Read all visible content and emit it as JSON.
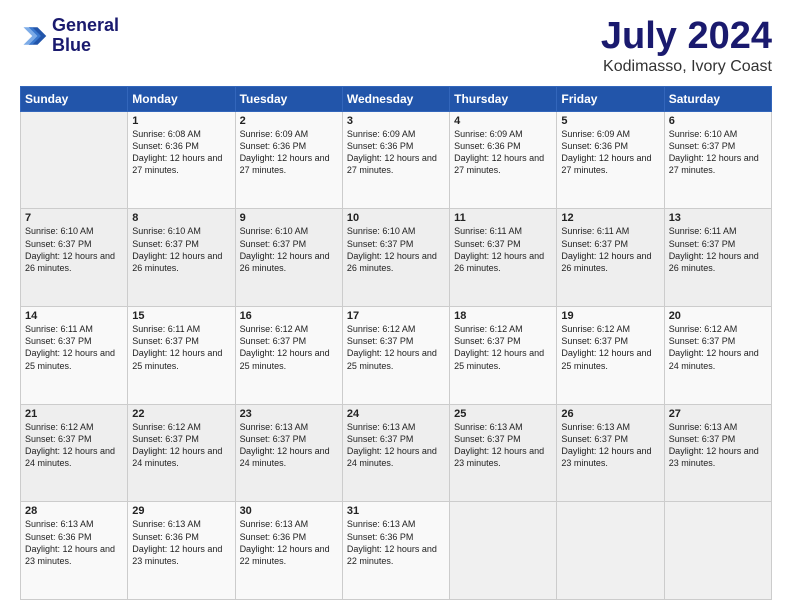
{
  "header": {
    "logo_line1": "General",
    "logo_line2": "Blue",
    "title": "July 2024",
    "subtitle": "Kodimasso, Ivory Coast"
  },
  "days_of_week": [
    "Sunday",
    "Monday",
    "Tuesday",
    "Wednesday",
    "Thursday",
    "Friday",
    "Saturday"
  ],
  "weeks": [
    [
      {
        "day": "",
        "sunrise": "",
        "sunset": "",
        "daylight": ""
      },
      {
        "day": "1",
        "sunrise": "Sunrise: 6:08 AM",
        "sunset": "Sunset: 6:36 PM",
        "daylight": "Daylight: 12 hours and 27 minutes."
      },
      {
        "day": "2",
        "sunrise": "Sunrise: 6:09 AM",
        "sunset": "Sunset: 6:36 PM",
        "daylight": "Daylight: 12 hours and 27 minutes."
      },
      {
        "day": "3",
        "sunrise": "Sunrise: 6:09 AM",
        "sunset": "Sunset: 6:36 PM",
        "daylight": "Daylight: 12 hours and 27 minutes."
      },
      {
        "day": "4",
        "sunrise": "Sunrise: 6:09 AM",
        "sunset": "Sunset: 6:36 PM",
        "daylight": "Daylight: 12 hours and 27 minutes."
      },
      {
        "day": "5",
        "sunrise": "Sunrise: 6:09 AM",
        "sunset": "Sunset: 6:36 PM",
        "daylight": "Daylight: 12 hours and 27 minutes."
      },
      {
        "day": "6",
        "sunrise": "Sunrise: 6:10 AM",
        "sunset": "Sunset: 6:37 PM",
        "daylight": "Daylight: 12 hours and 27 minutes."
      }
    ],
    [
      {
        "day": "7",
        "sunrise": "Sunrise: 6:10 AM",
        "sunset": "Sunset: 6:37 PM",
        "daylight": "Daylight: 12 hours and 26 minutes."
      },
      {
        "day": "8",
        "sunrise": "Sunrise: 6:10 AM",
        "sunset": "Sunset: 6:37 PM",
        "daylight": "Daylight: 12 hours and 26 minutes."
      },
      {
        "day": "9",
        "sunrise": "Sunrise: 6:10 AM",
        "sunset": "Sunset: 6:37 PM",
        "daylight": "Daylight: 12 hours and 26 minutes."
      },
      {
        "day": "10",
        "sunrise": "Sunrise: 6:10 AM",
        "sunset": "Sunset: 6:37 PM",
        "daylight": "Daylight: 12 hours and 26 minutes."
      },
      {
        "day": "11",
        "sunrise": "Sunrise: 6:11 AM",
        "sunset": "Sunset: 6:37 PM",
        "daylight": "Daylight: 12 hours and 26 minutes."
      },
      {
        "day": "12",
        "sunrise": "Sunrise: 6:11 AM",
        "sunset": "Sunset: 6:37 PM",
        "daylight": "Daylight: 12 hours and 26 minutes."
      },
      {
        "day": "13",
        "sunrise": "Sunrise: 6:11 AM",
        "sunset": "Sunset: 6:37 PM",
        "daylight": "Daylight: 12 hours and 26 minutes."
      }
    ],
    [
      {
        "day": "14",
        "sunrise": "Sunrise: 6:11 AM",
        "sunset": "Sunset: 6:37 PM",
        "daylight": "Daylight: 12 hours and 25 minutes."
      },
      {
        "day": "15",
        "sunrise": "Sunrise: 6:11 AM",
        "sunset": "Sunset: 6:37 PM",
        "daylight": "Daylight: 12 hours and 25 minutes."
      },
      {
        "day": "16",
        "sunrise": "Sunrise: 6:12 AM",
        "sunset": "Sunset: 6:37 PM",
        "daylight": "Daylight: 12 hours and 25 minutes."
      },
      {
        "day": "17",
        "sunrise": "Sunrise: 6:12 AM",
        "sunset": "Sunset: 6:37 PM",
        "daylight": "Daylight: 12 hours and 25 minutes."
      },
      {
        "day": "18",
        "sunrise": "Sunrise: 6:12 AM",
        "sunset": "Sunset: 6:37 PM",
        "daylight": "Daylight: 12 hours and 25 minutes."
      },
      {
        "day": "19",
        "sunrise": "Sunrise: 6:12 AM",
        "sunset": "Sunset: 6:37 PM",
        "daylight": "Daylight: 12 hours and 25 minutes."
      },
      {
        "day": "20",
        "sunrise": "Sunrise: 6:12 AM",
        "sunset": "Sunset: 6:37 PM",
        "daylight": "Daylight: 12 hours and 24 minutes."
      }
    ],
    [
      {
        "day": "21",
        "sunrise": "Sunrise: 6:12 AM",
        "sunset": "Sunset: 6:37 PM",
        "daylight": "Daylight: 12 hours and 24 minutes."
      },
      {
        "day": "22",
        "sunrise": "Sunrise: 6:12 AM",
        "sunset": "Sunset: 6:37 PM",
        "daylight": "Daylight: 12 hours and 24 minutes."
      },
      {
        "day": "23",
        "sunrise": "Sunrise: 6:13 AM",
        "sunset": "Sunset: 6:37 PM",
        "daylight": "Daylight: 12 hours and 24 minutes."
      },
      {
        "day": "24",
        "sunrise": "Sunrise: 6:13 AM",
        "sunset": "Sunset: 6:37 PM",
        "daylight": "Daylight: 12 hours and 24 minutes."
      },
      {
        "day": "25",
        "sunrise": "Sunrise: 6:13 AM",
        "sunset": "Sunset: 6:37 PM",
        "daylight": "Daylight: 12 hours and 23 minutes."
      },
      {
        "day": "26",
        "sunrise": "Sunrise: 6:13 AM",
        "sunset": "Sunset: 6:37 PM",
        "daylight": "Daylight: 12 hours and 23 minutes."
      },
      {
        "day": "27",
        "sunrise": "Sunrise: 6:13 AM",
        "sunset": "Sunset: 6:37 PM",
        "daylight": "Daylight: 12 hours and 23 minutes."
      }
    ],
    [
      {
        "day": "28",
        "sunrise": "Sunrise: 6:13 AM",
        "sunset": "Sunset: 6:36 PM",
        "daylight": "Daylight: 12 hours and 23 minutes."
      },
      {
        "day": "29",
        "sunrise": "Sunrise: 6:13 AM",
        "sunset": "Sunset: 6:36 PM",
        "daylight": "Daylight: 12 hours and 23 minutes."
      },
      {
        "day": "30",
        "sunrise": "Sunrise: 6:13 AM",
        "sunset": "Sunset: 6:36 PM",
        "daylight": "Daylight: 12 hours and 22 minutes."
      },
      {
        "day": "31",
        "sunrise": "Sunrise: 6:13 AM",
        "sunset": "Sunset: 6:36 PM",
        "daylight": "Daylight: 12 hours and 22 minutes."
      },
      {
        "day": "",
        "sunrise": "",
        "sunset": "",
        "daylight": ""
      },
      {
        "day": "",
        "sunrise": "",
        "sunset": "",
        "daylight": ""
      },
      {
        "day": "",
        "sunrise": "",
        "sunset": "",
        "daylight": ""
      }
    ]
  ]
}
